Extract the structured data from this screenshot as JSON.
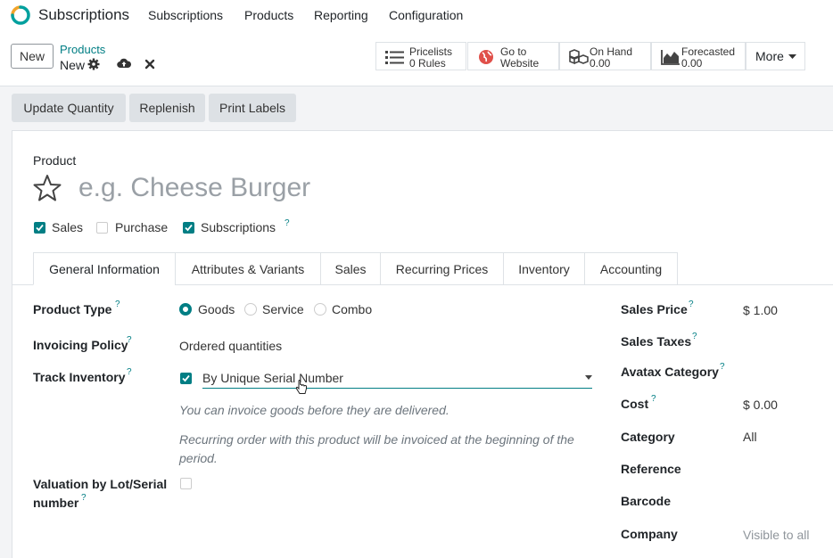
{
  "navbar": {
    "app_name": "Subscriptions",
    "menu": [
      "Subscriptions",
      "Products",
      "Reporting",
      "Configuration"
    ]
  },
  "control_panel": {
    "new_label": "New",
    "breadcrumb_parent": "Products",
    "breadcrumb_current": "New",
    "stat_buttons": [
      {
        "line1": "Pricelists",
        "line2": "0 Rules",
        "icon": "list-icon"
      },
      {
        "line1": "Go to",
        "line2": "Website",
        "icon": "globe-icon"
      },
      {
        "line1": "On Hand",
        "line2": "0.00",
        "icon": "cubes-icon"
      },
      {
        "line1": "Forecasted",
        "line2": "0.00",
        "icon": "area-chart-icon"
      }
    ],
    "more_label": "More"
  },
  "action_buttons": [
    "Update Quantity",
    "Replenish",
    "Print Labels"
  ],
  "form": {
    "product_label": "Product",
    "name_placeholder": "e.g. Cheese Burger",
    "options": [
      {
        "label": "Sales",
        "checked": true
      },
      {
        "label": "Purchase",
        "checked": false
      },
      {
        "label": "Subscriptions",
        "checked": true,
        "help": "?"
      }
    ],
    "tabs": [
      "General Information",
      "Attributes & Variants",
      "Sales",
      "Recurring Prices",
      "Inventory",
      "Accounting"
    ],
    "active_tab": "General Information",
    "left_fields": {
      "product_type": {
        "label": "Product Type",
        "options": [
          "Goods",
          "Service",
          "Combo"
        ],
        "selected": "Goods"
      },
      "invoicing_policy": {
        "label": "Invoicing Policy",
        "value": "Ordered quantities"
      },
      "track_inventory": {
        "label": "Track Inventory",
        "checked": true,
        "value": "By Unique Serial Number"
      },
      "notes": [
        "You can invoice goods before they are delivered.",
        "Recurring order with this product will be invoiced at the beginning of the",
        "period."
      ],
      "valuation": {
        "label_line1": "Valuation by Lot/Serial",
        "label_line2": "number",
        "checked": false
      }
    },
    "right_fields": [
      {
        "label": "Sales Price",
        "value": "$ 1.00",
        "help": true
      },
      {
        "label": "Sales Taxes",
        "value": "",
        "help": true
      },
      {
        "label": "Avatax Category",
        "value": "",
        "help": true
      },
      {
        "label": "Cost",
        "value": "$ 0.00",
        "help": true
      },
      {
        "label": "Category",
        "value": "All",
        "help": false
      },
      {
        "label": "Reference",
        "value": "",
        "help": false
      },
      {
        "label": "Barcode",
        "value": "",
        "help": false
      },
      {
        "label": "Company",
        "value": "Visible to all",
        "help": false
      }
    ],
    "help_mark": "?"
  },
  "colors": {
    "accent": "#017e84",
    "logo_orange": "#f1a42a",
    "logo_teal": "#01a09e",
    "globe_red": "#e0504a"
  }
}
